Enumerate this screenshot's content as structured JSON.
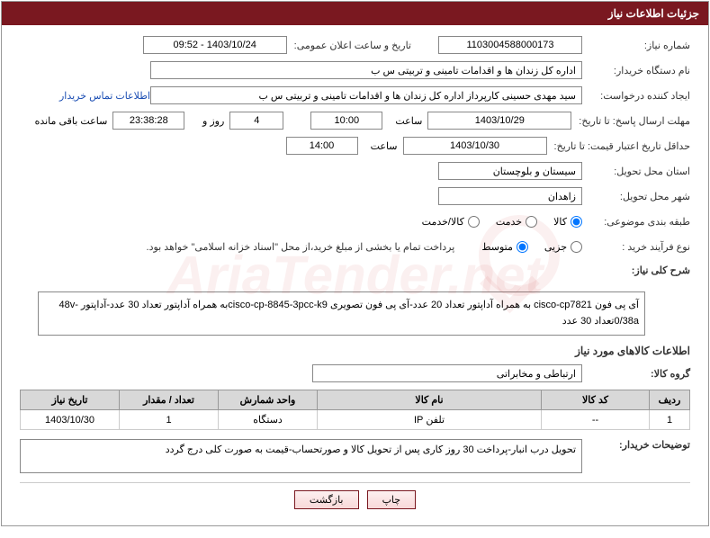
{
  "header": {
    "title": "جزئیات اطلاعات نیاز"
  },
  "fields": {
    "need_no_label": "شماره نیاز:",
    "need_no": "1103004588000173",
    "announce_label": "تاریخ و ساعت اعلان عمومی:",
    "announce_value": "1403/10/24 - 09:52",
    "buyer_label": "نام دستگاه خریدار:",
    "buyer_value": "اداره کل زندان ها و اقدامات تامینی و تربیتی س ب",
    "creator_label": "ایجاد کننده درخواست:",
    "creator_value": "سید مهدی حسینی کارپرداز اداره کل زندان ها و اقدامات تامینی و تربیتی س ب",
    "contact_link": "اطلاعات تماس خریدار",
    "deadline_label": "مهلت ارسال پاسخ: تا تاریخ:",
    "deadline_date": "1403/10/29",
    "hour_label": "ساعت",
    "deadline_time": "10:00",
    "days_count": "4",
    "days_label": "روز و",
    "countdown": "23:38:28",
    "remaining_label": "ساعت باقی مانده",
    "validity_label": "حداقل تاریخ اعتبار قیمت: تا تاریخ:",
    "validity_date": "1403/10/30",
    "validity_time": "14:00",
    "province_label": "استان محل تحویل:",
    "province_value": "سیستان و بلوچستان",
    "city_label": "شهر محل تحویل:",
    "city_value": "زاهدان",
    "category_label": "طبقه بندی موضوعی:",
    "cat_goods": "کالا",
    "cat_service": "خدمت",
    "cat_both": "کالا/خدمت",
    "process_label": "نوع فرآیند خرید :",
    "proc_minor": "جزیی",
    "proc_medium": "متوسط",
    "payment_note": "پرداخت تمام یا بخشی از مبلغ خرید،از محل \"اسناد خزانه اسلامی\" خواهد بود.",
    "summary_label": "شرح کلی نیاز:",
    "summary_value": "آی پی فون cisco-cp7821 به همراه آداپتور تعداد 20 عدد-آی پی فون تصویری cisco-cp-8845-3pcc-k9به همراه آداپتور تعداد 30 عدد-آداپتور 48v-0/38aتعداد 30 عدد",
    "goods_section": "اطلاعات کالاهای مورد نیاز",
    "group_label": "گروه کالا:",
    "group_value": "ارتباطی و مخابراتی",
    "buyer_notes_label": "توضیحات خریدار:",
    "buyer_notes_value": "تحویل درب انبار-پرداخت 30 روز کاری پس از تحویل کالا و صورتحساب-قیمت به صورت کلی درج گردد"
  },
  "table": {
    "headers": {
      "row": "ردیف",
      "code": "کد کالا",
      "name": "نام کالا",
      "unit": "واحد شمارش",
      "qty": "تعداد / مقدار",
      "date": "تاریخ نیاز"
    },
    "rows": [
      {
        "row": "1",
        "code": "--",
        "name": "تلفن IP",
        "unit": "دستگاه",
        "qty": "1",
        "date": "1403/10/30"
      }
    ]
  },
  "buttons": {
    "print": "چاپ",
    "back": "بازگشت"
  },
  "chart_data": {
    "type": "table",
    "title": "اطلاعات کالاهای مورد نیاز",
    "columns": [
      "ردیف",
      "کد کالا",
      "نام کالا",
      "واحد شمارش",
      "تعداد / مقدار",
      "تاریخ نیاز"
    ],
    "rows": [
      [
        "1",
        "--",
        "تلفن IP",
        "دستگاه",
        "1",
        "1403/10/30"
      ]
    ]
  }
}
